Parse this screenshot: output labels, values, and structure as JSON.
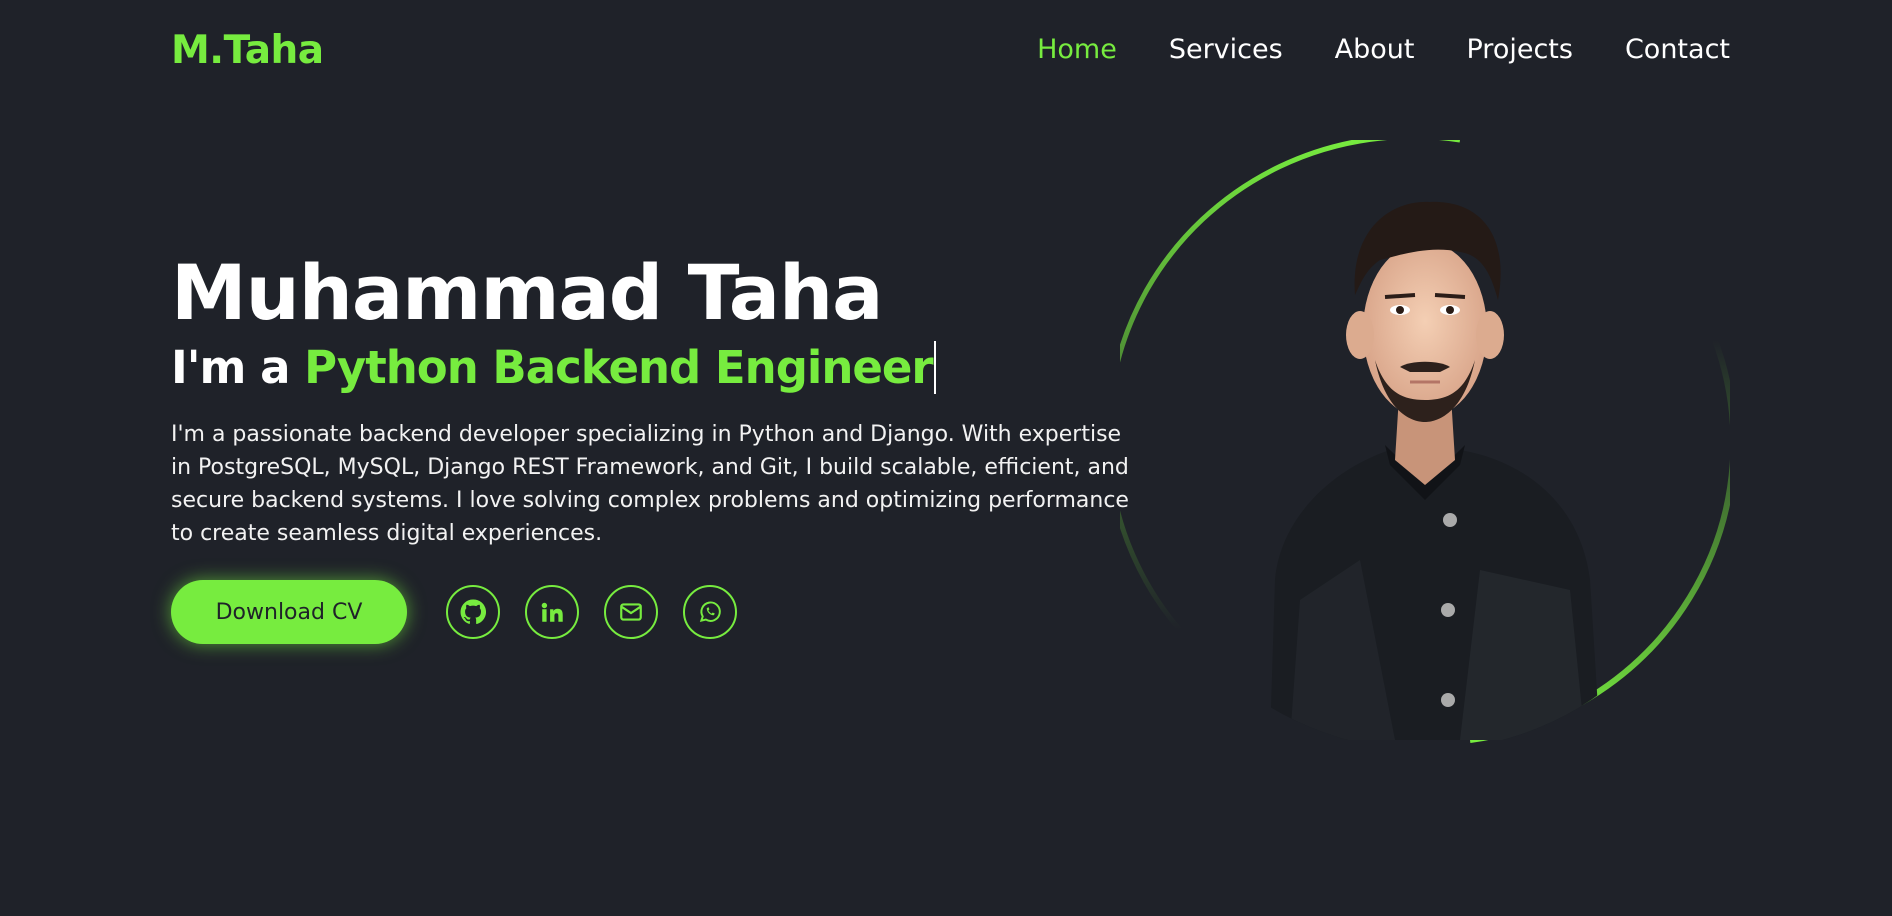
{
  "header": {
    "logo": "M.Taha",
    "nav": [
      {
        "label": "Home",
        "active": true
      },
      {
        "label": "Services",
        "active": false
      },
      {
        "label": "About",
        "active": false
      },
      {
        "label": "Projects",
        "active": false
      },
      {
        "label": "Contact",
        "active": false
      }
    ]
  },
  "hero": {
    "name": "Muhammad Taha",
    "role_prefix": "I'm a ",
    "role_highlight": "Python Backend Engineer",
    "description": "I'm a passionate backend developer specializing in Python and Django. With expertise in PostgreSQL, MySQL, Django REST Framework, and Git, I build scalable, efficient, and secure backend systems. I love solving complex problems and optimizing performance to create seamless digital experiences.",
    "cv_button": "Download CV",
    "socials": [
      "github-icon",
      "linkedin-icon",
      "mail-icon",
      "whatsapp-icon"
    ]
  },
  "colors": {
    "background": "#1f2229",
    "accent": "#77ec3f",
    "text": "#ffffff"
  }
}
